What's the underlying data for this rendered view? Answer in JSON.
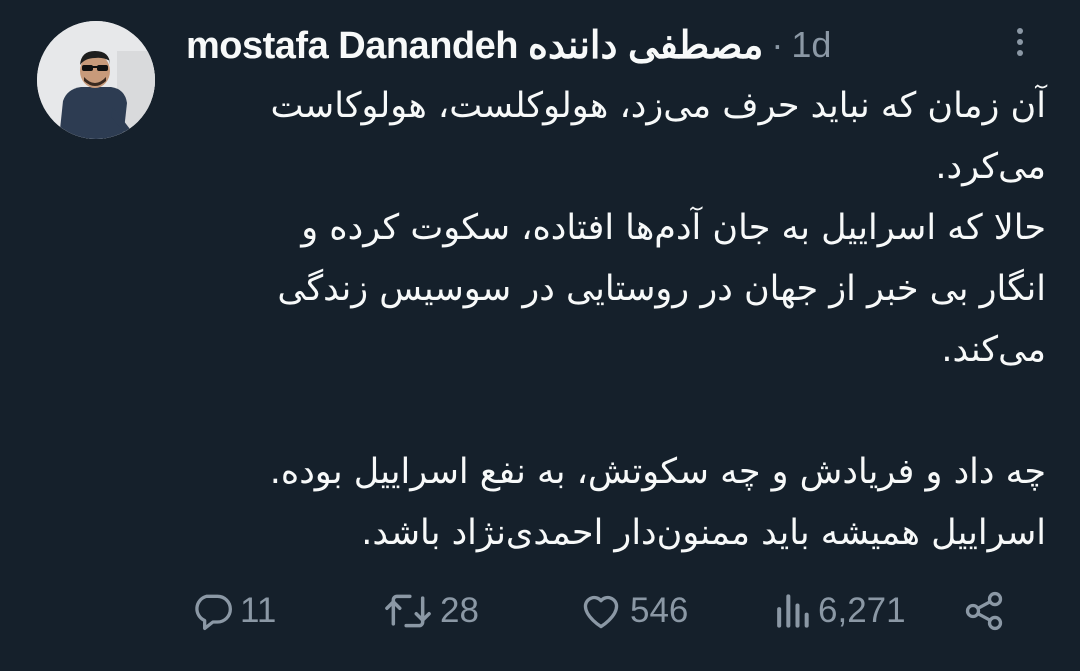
{
  "author": {
    "display_name": "mostafa Danandeh مصطفی داننده",
    "separator": "·",
    "timestamp": "1d"
  },
  "tweet": {
    "lines": [
      "آن زمان که نباید حرف می‌زد، هولوکلست، هولوکاست",
      "می‌کرد.",
      "حالا که اسراییل به جان آدم‌ها افتاده، سکوت کرده و",
      "انگار بی خبر از جهان در روستایی در سوسیس زندگی",
      "می‌کند.",
      "",
      "چه داد و فریادش و چه سکوتش، به نفع اسراییل بوده.",
      "اسراییل همیشه باید ممنون‌دار احمدی‌نژاد باشد."
    ]
  },
  "actions": {
    "reply_count": "11",
    "retweet_count": "28",
    "like_count": "546",
    "view_count": "6,271"
  },
  "icons": {
    "reply": "reply-icon",
    "retweet": "retweet-icon",
    "like": "heart-icon",
    "views": "views-icon",
    "share": "share-icon",
    "more": "more-icon"
  },
  "colors": {
    "background": "#15202b",
    "text_primary": "#f7f9f9",
    "text_secondary": "#8b98a5"
  }
}
